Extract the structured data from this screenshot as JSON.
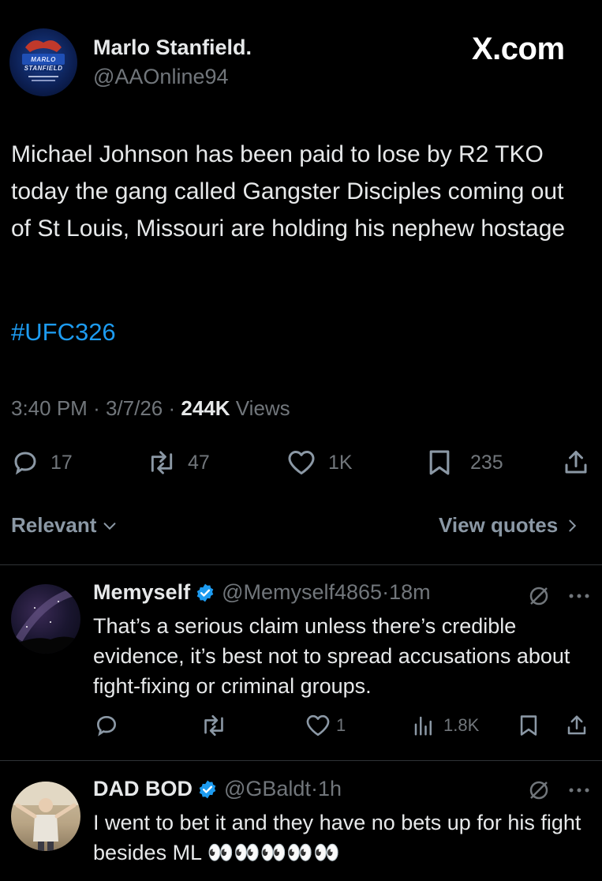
{
  "post": {
    "author_name": "Marlo Stanfield.",
    "author_handle": "@AAOnline94",
    "watermark": "X.com",
    "avatar_text": "MARLO STANFIELD",
    "body": "Michael Johnson has been paid to lose by R2 TKO today the gang called Gangster Disciples coming out of St Louis, Missouri are holding his nephew hostage",
    "hashtag": "#UFC326",
    "time": "3:40 PM",
    "date": "3/7/26",
    "views_count": "244K",
    "views_label": "Views",
    "replies": "17",
    "reposts": "47",
    "likes": "1K",
    "bookmarks": "235"
  },
  "filter": {
    "relevant_label": "Relevant",
    "view_quotes_label": "View quotes"
  },
  "replies": [
    {
      "name": "Memyself",
      "handle": "@Memyself4865",
      "time": "18m",
      "text": "That’s a serious claim unless there’s credible evidence, it’s best not to spread accusations about fight-fixing or criminal groups.",
      "likes": "1",
      "views": "1.8K"
    },
    {
      "name": "DAD BOD",
      "handle": "@GBaldt",
      "time": "1h",
      "text": "I went to bet it and they have no bets up for his fight besides ML 👀👀👀👀👀"
    }
  ],
  "colors": {
    "background": "#000000",
    "text": "#e7e9ea",
    "muted": "#71767b",
    "link": "#1d9bf0",
    "verified": "#1d9bf0",
    "divider": "#2f3336"
  }
}
